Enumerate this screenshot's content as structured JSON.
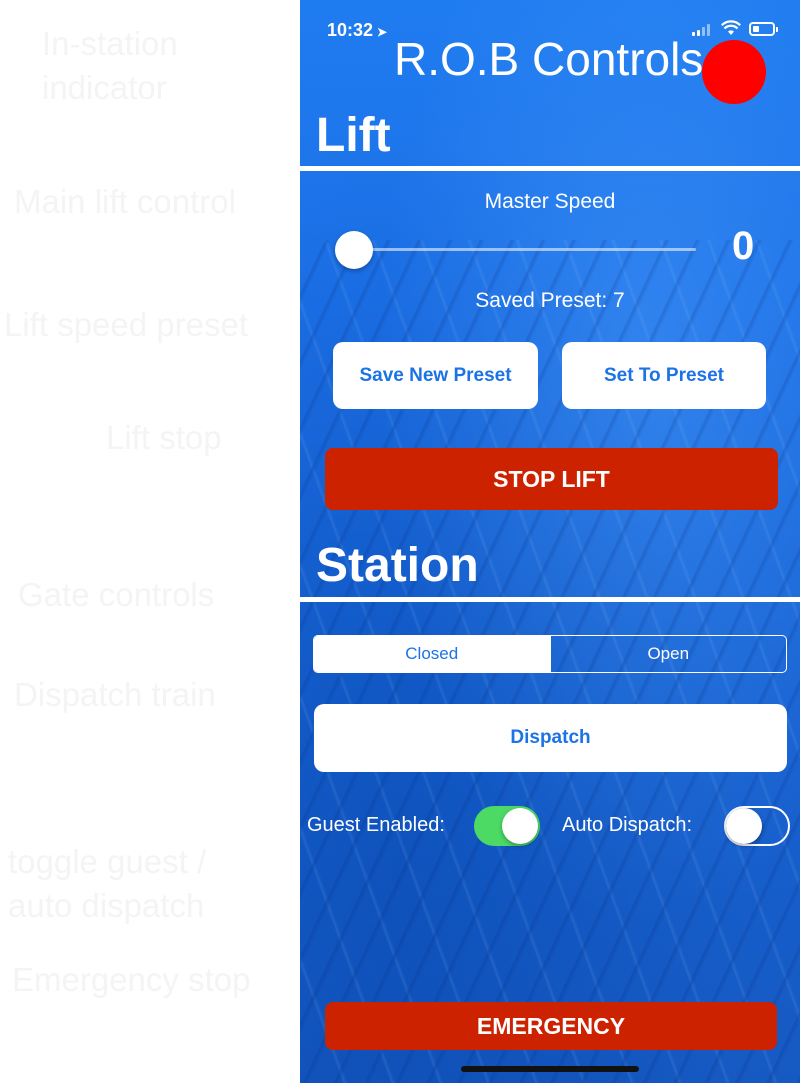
{
  "annotations": {
    "in_station_indicator": "In-station\nindicator",
    "main_lift_control": "Main lift control",
    "lift_speed_preset": "Lift speed preset",
    "lift_stop": "Lift stop",
    "gate_controls": "Gate controls",
    "dispatch_train": "Dispatch train",
    "toggle_guest_auto": "toggle guest /\nauto dispatch",
    "emergency_stop": "Emergency stop"
  },
  "status_bar": {
    "time": "10:32",
    "location_icon": "location-arrow-icon"
  },
  "app": {
    "title": "R.O.B Controls",
    "indicator_color": "#ff0000"
  },
  "lift": {
    "heading": "Lift",
    "master_speed_label": "Master Speed",
    "master_speed_value": "0",
    "master_speed_fraction": 0,
    "saved_preset_label": "Saved Preset: 7",
    "save_preset_button": "Save New Preset",
    "set_preset_button": "Set To Preset",
    "stop_button": "STOP LIFT"
  },
  "station": {
    "heading": "Station",
    "gate_options": [
      "Closed",
      "Open"
    ],
    "gate_selected": "Closed",
    "dispatch_button": "Dispatch",
    "guest_enabled_label": "Guest Enabled:",
    "guest_enabled": true,
    "auto_dispatch_label": "Auto Dispatch:",
    "auto_dispatch": false
  },
  "emergency_button": "EMERGENCY",
  "colors": {
    "background_blue": "#1c6fe6",
    "accent_text_blue": "#1c73e6",
    "stop_red": "#cc2200",
    "toggle_green": "#4cd964"
  }
}
